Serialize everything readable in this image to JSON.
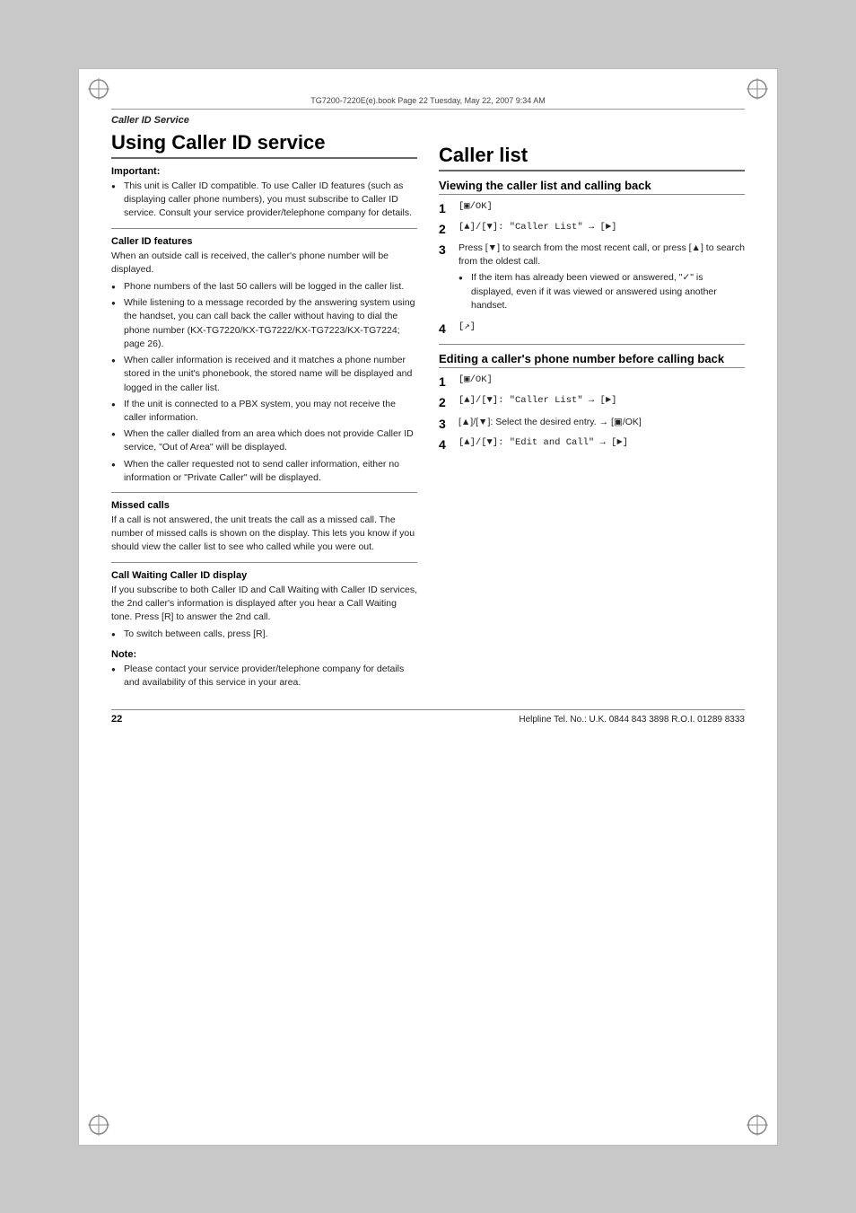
{
  "meta": {
    "file_info": "TG7200-7220E(e).book  Page 22  Tuesday, May 22, 2007  9:34 AM"
  },
  "section_label": "Caller ID Service",
  "left_col": {
    "main_heading": "Using Caller ID service",
    "important_label": "Important:",
    "important_bullets": [
      "This unit is Caller ID compatible. To use Caller ID features (such as displaying caller phone numbers), you must subscribe to Caller ID service. Consult your service provider/telephone company for details."
    ],
    "caller_id_features_heading": "Caller ID features",
    "caller_id_features_intro": "When an outside call is received, the caller's phone number will be displayed.",
    "caller_id_bullets": [
      "Phone numbers of the last 50 callers will be logged in the caller list.",
      "While listening to a message recorded by the answering system using the handset, you can call back the caller without having to dial the phone number (KX-TG7220/KX-TG7222/KX-TG7223/KX-TG7224; page 26).",
      "When caller information is received and it matches a phone number stored in the unit's phonebook, the stored name will be displayed and logged in the caller list.",
      "If the unit is connected to a PBX system, you may not receive the caller information.",
      "When the caller dialled from an area which does not provide Caller ID service, \"Out of Area\" will be displayed.",
      "When the caller requested not to send caller information, either no information or \"Private Caller\" will be displayed."
    ],
    "missed_calls_heading": "Missed calls",
    "missed_calls_text": "If a call is not answered, the unit treats the call as a missed call. The number of missed calls is shown on the display. This lets you know if you should view the caller list to see who called while you were out.",
    "call_waiting_heading": "Call Waiting Caller ID display",
    "call_waiting_text": "If you subscribe to both Caller ID and Call Waiting with Caller ID services, the 2nd caller's information is displayed after you hear a Call Waiting tone. Press [R] to answer the 2nd call.",
    "call_waiting_bullets": [
      "To switch between calls, press [R]."
    ],
    "note_label": "Note:",
    "note_bullets": [
      "Please contact your service provider/telephone company for details and availability of this service in your area."
    ]
  },
  "right_col": {
    "main_heading": "Caller list",
    "view_section_heading": "Viewing the caller list and calling back",
    "view_steps": [
      {
        "num": "1",
        "content": "[▣/OK]"
      },
      {
        "num": "2",
        "content": "[▲]/[▼]: \"Caller List\" → [►]"
      },
      {
        "num": "3",
        "content": "Press [▼] to search from the most recent call, or press [▲] to search from the oldest call.",
        "bullets": [
          "If the item has already been viewed or answered, \"✓\" is displayed, even if it was viewed or answered using another handset."
        ]
      },
      {
        "num": "4",
        "content": "[↗]"
      }
    ],
    "edit_section_heading": "Editing a caller's phone number before calling back",
    "edit_steps": [
      {
        "num": "1",
        "content": "[▣/OK]"
      },
      {
        "num": "2",
        "content": "[▲]/[▼]: \"Caller List\" → [►]"
      },
      {
        "num": "3",
        "content": "[▲]/[▼]: Select the desired entry. → [▣/OK]"
      },
      {
        "num": "4",
        "content": "[▲]/[▼]: \"Edit and Call\" → [►]"
      }
    ]
  },
  "footer": {
    "page_num": "22",
    "helpline": "Helpline Tel. No.: U.K. 0844 843 3898 R.O.I. 01289 8333"
  }
}
